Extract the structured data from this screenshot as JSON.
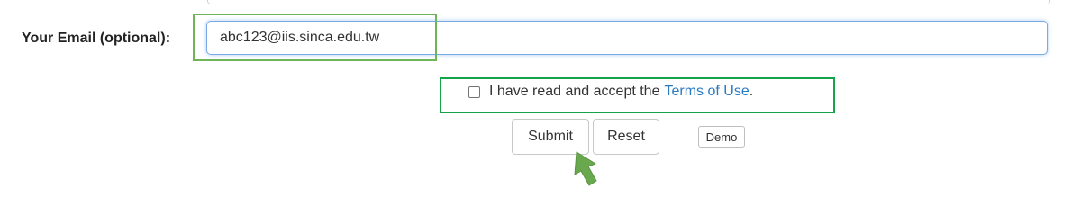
{
  "form": {
    "email_label": "Your Email (optional):",
    "email_value": "abc123@iis.sinca.edu.tw",
    "terms_text": "I have read and accept the",
    "terms_link": "Terms of Use",
    "terms_period": ".",
    "terms_checked": false
  },
  "buttons": {
    "submit": "Submit",
    "reset": "Reset",
    "demo": "Demo"
  },
  "colors": {
    "highlight_box": "#6fb557",
    "link": "#2a7ac2",
    "input_focus": "#79a9e6",
    "arrow": "#6aa84f"
  },
  "icons": {
    "pointer": "arrow-pointer-icon"
  }
}
